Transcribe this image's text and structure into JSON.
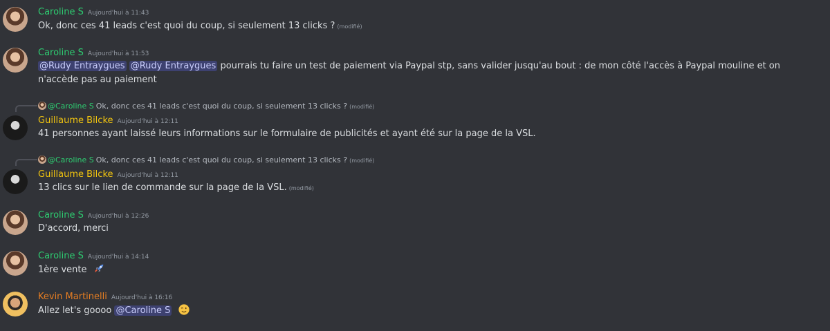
{
  "messages": [
    {
      "author": "Caroline S",
      "time": "Aujourd'hui à 11:43",
      "text": "Ok, donc ces 41 leads c'est quoi du coup, si seulement 13 clicks ?",
      "edited": "(modifié)"
    },
    {
      "author": "Caroline S",
      "time": "Aujourd'hui à 11:53",
      "mentions": [
        "@Rudy Entraygues",
        "@Rudy Entraygues"
      ],
      "text": "pourrais tu faire un test de paiement via Paypal stp, sans valider jusqu'au bout : de mon côté l'accès à Paypal mouline et on n'accède pas au paiement"
    },
    {
      "reply": {
        "name": "@Caroline S",
        "text": "Ok, donc ces 41 leads c'est quoi du coup, si seulement 13 clicks ?",
        "edited": "(modifié)"
      },
      "author": "Guillaume Bilcke",
      "time": "Aujourd'hui à 12:11",
      "text": "41 personnes ayant laissé leurs informations sur le formulaire de publicités et ayant été sur la page de la VSL."
    },
    {
      "reply": {
        "name": "@Caroline S",
        "text": "Ok, donc ces 41 leads c'est quoi du coup, si seulement 13 clicks ?",
        "edited": "(modifié)"
      },
      "author": "Guillaume Bilcke",
      "time": "Aujourd'hui à 12:11",
      "text": "13 clics sur le lien de commande sur la page de la VSL.",
      "edited": "(modifié)"
    },
    {
      "author": "Caroline S",
      "time": "Aujourd'hui à 12:26",
      "text": "D'accord, merci"
    },
    {
      "author": "Caroline S",
      "time": "Aujourd'hui à 14:14",
      "text": "1ère vente",
      "emoji": "rocket-emoji"
    },
    {
      "author": "Kevin Martinelli",
      "time": "Aujourd'hui à 16:16",
      "text": "Allez let's goooo",
      "mention": "@Caroline S",
      "emoji": "winking-face-emoji"
    }
  ],
  "colors": {
    "background": "#313338",
    "caroline": "#2ecc71",
    "guillaume": "#f1c40f",
    "kevin": "#e67e22",
    "mention_bg": "#3c4270"
  }
}
